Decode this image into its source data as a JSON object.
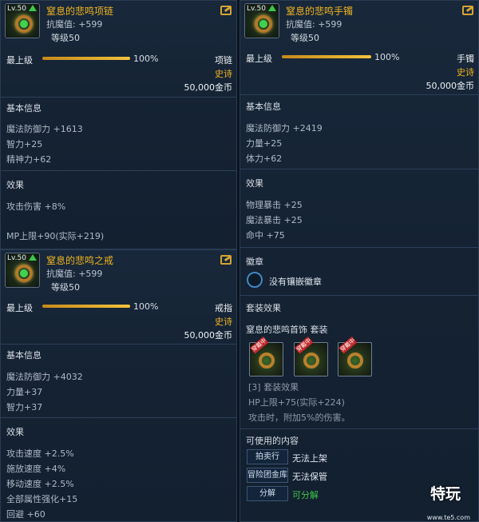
{
  "necklace": {
    "level_badge": "Lv.50",
    "name": "窒息的悲鸣项链",
    "resist": "抗魔值: +599",
    "level_req": "等级50",
    "grade_label": "最上级",
    "grade_pct": "100%",
    "grade_value": 1.0,
    "slot": "项链",
    "rarity": "史诗",
    "price": "50,000金币",
    "basic_title": "基本信息",
    "stats": [
      "魔法防御力 +1613",
      "智力+25",
      "精神力+62"
    ],
    "effect_title": "效果",
    "effects": [
      "攻击伤害 +8%",
      "MP上限+90(实际+219)"
    ]
  },
  "bracelet": {
    "level_badge": "Lv.50",
    "name": "窒息的悲鸣手镯",
    "resist": "抗魔值: +599",
    "level_req": "等级50",
    "grade_label": "最上级",
    "grade_pct": "100%",
    "grade_value": 1.0,
    "slot": "手镯",
    "rarity": "史诗",
    "price": "50,000金币",
    "basic_title": "基本信息",
    "stats": [
      "魔法防御力 +2419",
      "力量+25",
      "体力+62"
    ],
    "effect_title": "效果",
    "effects": [
      "物理暴击 +25",
      "魔法暴击 +25",
      "命中 +75"
    ],
    "emblem_title": "徽章",
    "emblem_text": "没有镶嵌徽章",
    "set_title": "套装效果",
    "set_name": "窒息的悲鸣首饰 套装",
    "set_icon_tags": [
      "穿戴中",
      "穿戴中",
      "穿戴中"
    ],
    "set_bonus_title": "[3] 套装效果",
    "set_bonus_hp": "HP上限+75(实际+224)",
    "set_bonus_attack": "攻击时，附加5%的伤害。",
    "usable_title": "可使用的内容",
    "usable": [
      {
        "btn": "拍卖行",
        "status": "无法上架"
      },
      {
        "btn": "冒险团金库",
        "status": "无法保管"
      },
      {
        "btn": "分解",
        "status": "可分解"
      }
    ],
    "colors": {
      "ok": "#3ec74a"
    }
  },
  "ring": {
    "level_badge": "Lv.50",
    "name": "窒息的悲鸣之戒",
    "resist": "抗魔值: +599",
    "level_req": "等级50",
    "grade_label": "最上级",
    "grade_pct": "100%",
    "grade_value": 1.0,
    "slot": "戒指",
    "rarity": "史诗",
    "price": "50,000金币",
    "basic_title": "基本信息",
    "stats": [
      "魔法防御力 +4032",
      "力量+37",
      "智力+37"
    ],
    "effect_title": "效果",
    "effects": [
      "攻击速度 +2.5%",
      "施放速度 +4%",
      "移动速度 +2.5%",
      "全部属性强化+15",
      "回避 +60"
    ]
  },
  "watermark": {
    "brand": "特玩",
    "url": "www.te5.com"
  }
}
